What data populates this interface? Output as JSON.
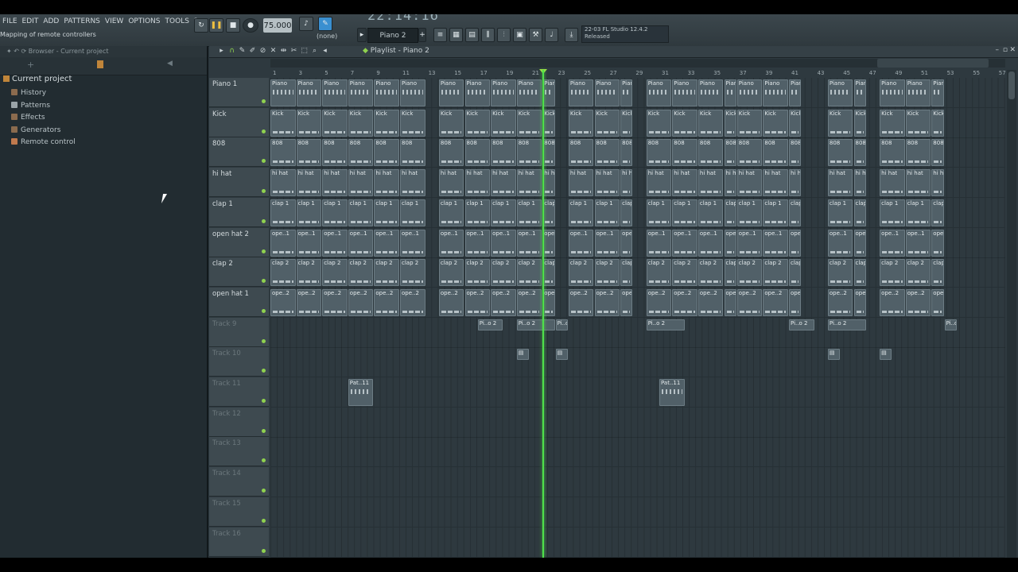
{
  "menu": [
    "FILE",
    "EDIT",
    "ADD",
    "PATTERNS",
    "VIEW",
    "OPTIONS",
    "TOOLS",
    "?"
  ],
  "hint_text": "Mapping of remote controllers",
  "tempo": "75.000",
  "time_display": "22:14:16",
  "pattern_selector": "Piano 2",
  "snap_selector": "(none)",
  "news": {
    "line1": "22-03  FL Studio 12.4.2",
    "line2": "Released"
  },
  "browser": {
    "path": "Browser - Current project",
    "root": "Current project",
    "items": [
      "History",
      "Patterns",
      "Effects",
      "Generators",
      "Remote control"
    ]
  },
  "playlist": {
    "title": "Playlist - Piano 2",
    "bar_numbers": [
      "1",
      "3",
      "5",
      "7",
      "9",
      "11",
      "13",
      "15",
      "17",
      "19",
      "21",
      "23",
      "25",
      "27",
      "29",
      "31",
      "33",
      "35",
      "37",
      "39",
      "41",
      "43",
      "45",
      "47",
      "49",
      "51",
      "53",
      "55",
      "57"
    ],
    "tracks": [
      {
        "name": "Piano 1",
        "empty": false,
        "clip": "Piano",
        "kind": "melodic"
      },
      {
        "name": "Kick",
        "empty": false,
        "clip": "Kick",
        "kind": "perc"
      },
      {
        "name": "808",
        "empty": false,
        "clip": "808",
        "kind": "perc"
      },
      {
        "name": "hi hat",
        "empty": false,
        "clip": "hi hat",
        "kind": "perc"
      },
      {
        "name": "clap 1",
        "empty": false,
        "clip": "clap 1",
        "kind": "perc"
      },
      {
        "name": "open hat 2",
        "empty": false,
        "clip": "ope..1",
        "kind": "perc"
      },
      {
        "name": "clap 2",
        "empty": false,
        "clip": "clap 2",
        "kind": "perc"
      },
      {
        "name": "open hat 1",
        "empty": false,
        "clip": "ope..2",
        "kind": "perc"
      },
      {
        "name": "Track 9",
        "empty": true,
        "clip": "Pi..o 2",
        "kind": "melodic"
      },
      {
        "name": "Track 10",
        "empty": true,
        "clip": "",
        "kind": "melodic"
      },
      {
        "name": "Track 11",
        "empty": true,
        "clip": "Pat..11",
        "kind": "melodic"
      },
      {
        "name": "Track 12",
        "empty": true,
        "clip": "",
        "kind": "none"
      },
      {
        "name": "Track 13",
        "empty": true,
        "clip": "",
        "kind": "none"
      },
      {
        "name": "Track 14",
        "empty": true,
        "clip": "",
        "kind": "none"
      },
      {
        "name": "Track 15",
        "empty": true,
        "clip": "",
        "kind": "none"
      },
      {
        "name": "Track 16",
        "empty": true,
        "clip": "",
        "kind": "none"
      }
    ],
    "playhead_bar": 22
  }
}
